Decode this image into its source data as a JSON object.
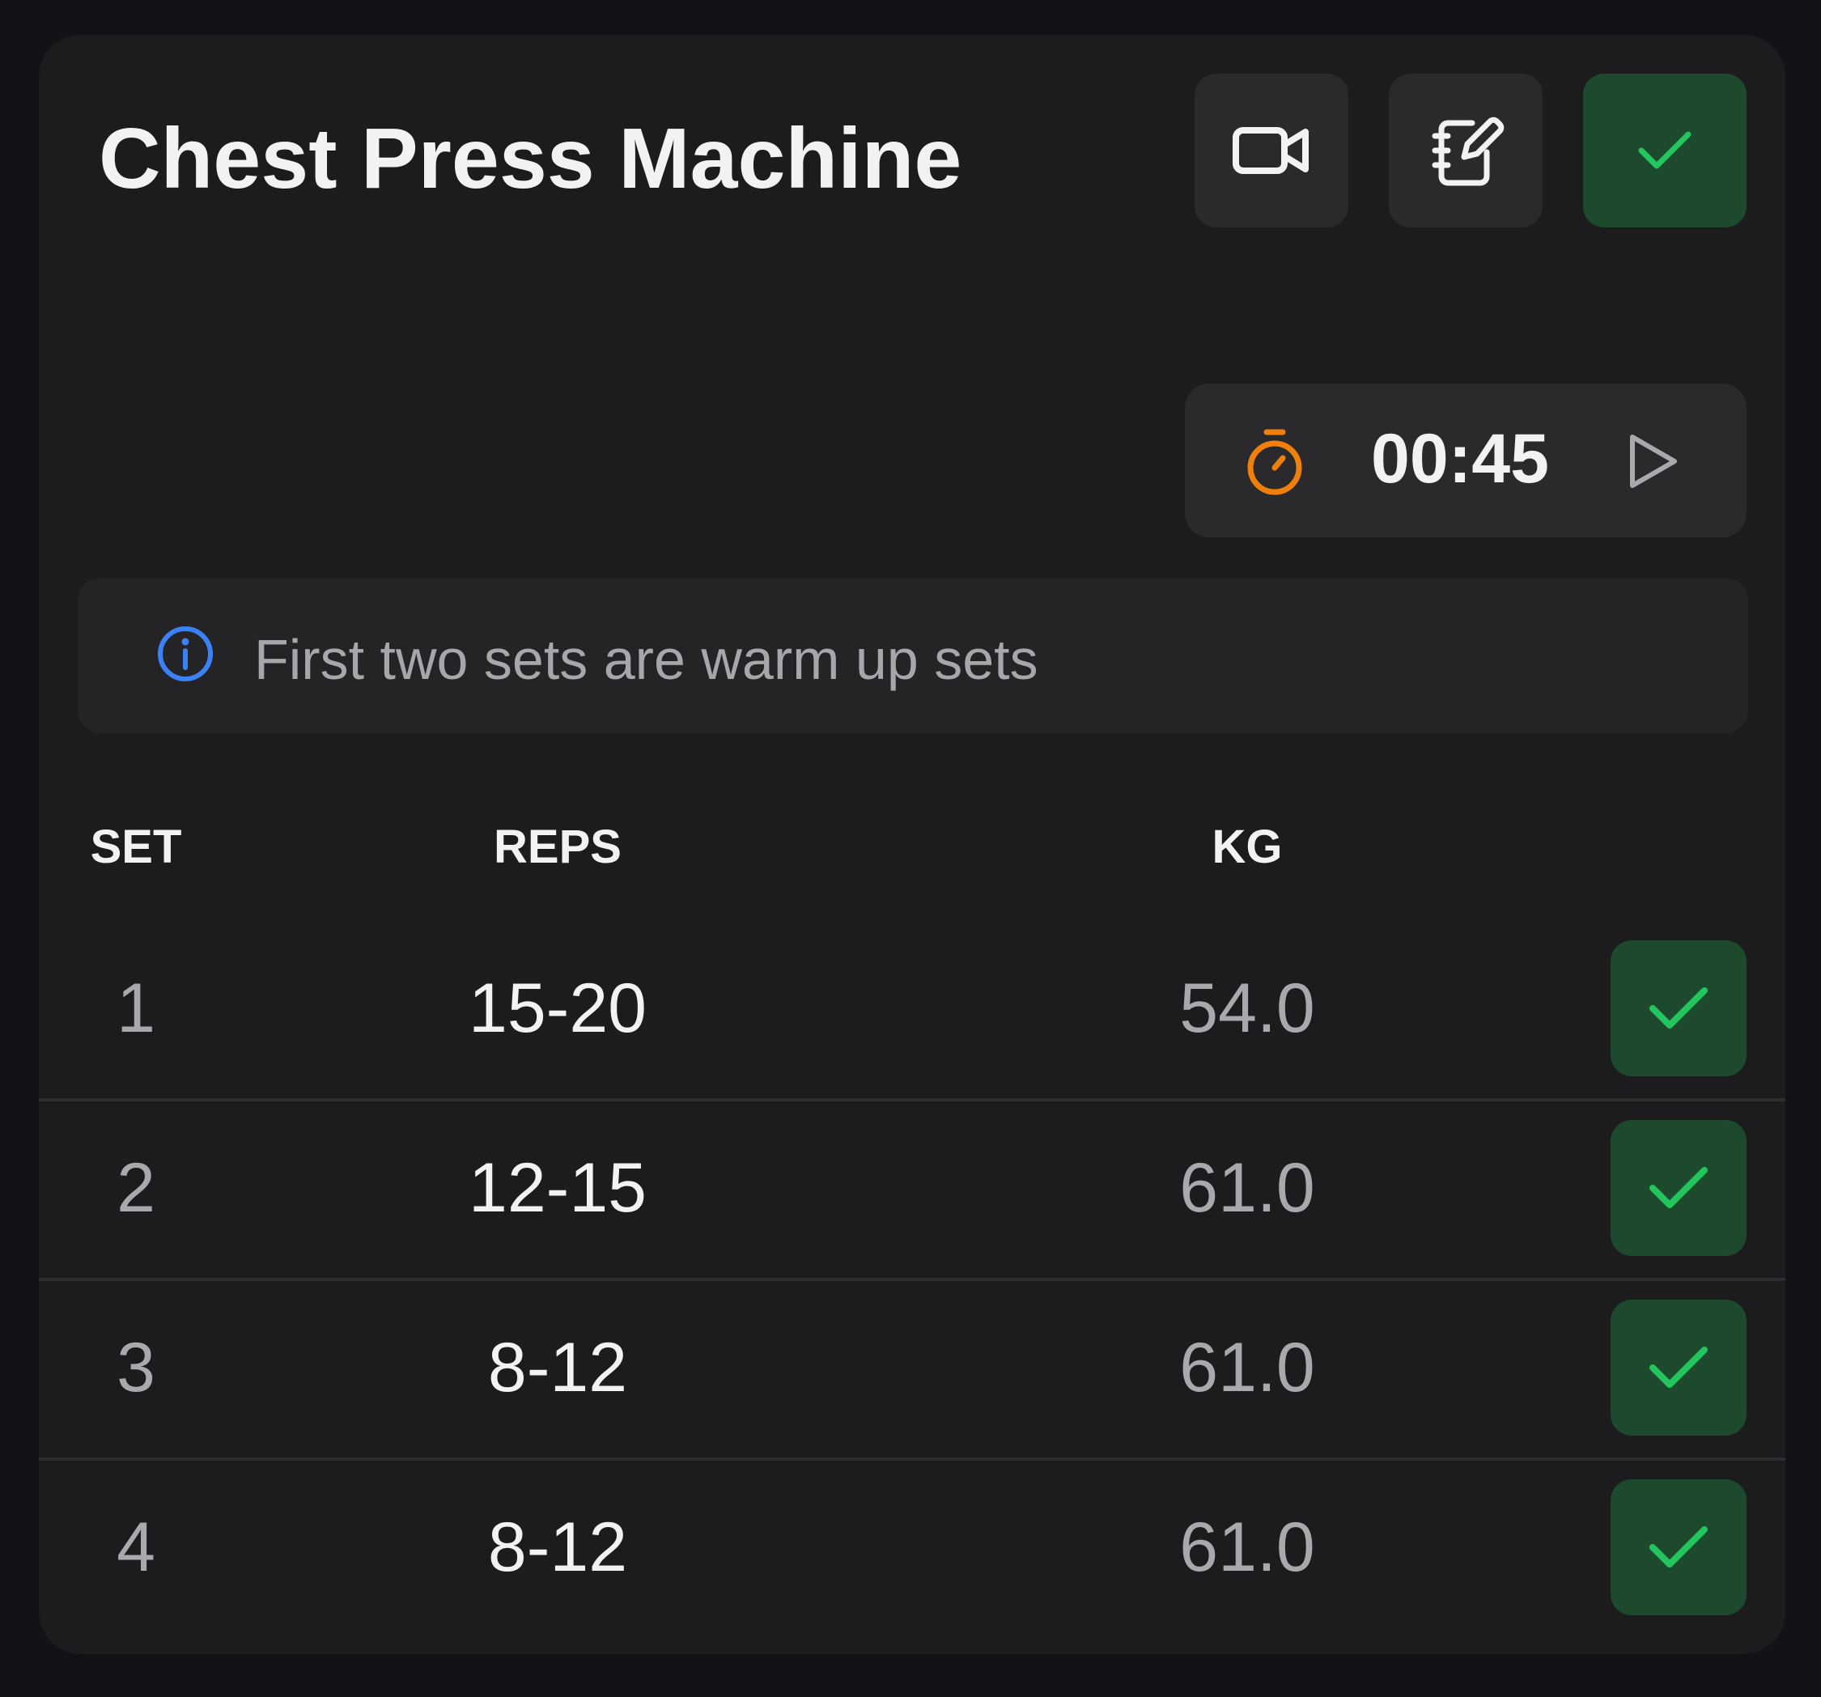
{
  "exercise": {
    "title": "Chest Press Machine",
    "actions": [
      {
        "icon": "video-camera-icon"
      },
      {
        "icon": "notebook-edit-icon"
      },
      {
        "icon": "checkmark-icon"
      }
    ]
  },
  "timer": {
    "icon": "stopwatch-icon",
    "value": "00:45",
    "play_icon": "play-icon"
  },
  "note": {
    "icon": "info-icon",
    "text": "First two sets are warm up sets"
  },
  "table": {
    "columns": [
      "SET",
      "REPS",
      "KG"
    ],
    "rows": [
      {
        "set": "1",
        "reps": "15-20",
        "kg": "54.0",
        "done": true
      },
      {
        "set": "2",
        "reps": "12-15",
        "kg": "61.0",
        "done": true
      },
      {
        "set": "3",
        "reps": "8-12",
        "kg": "61.0",
        "done": true
      },
      {
        "set": "4",
        "reps": "8-12",
        "kg": "61.0",
        "done": true
      }
    ]
  },
  "colors": {
    "background": "#121316",
    "card": "#1c1c1f",
    "button": "#2a2a2d",
    "success_bg": "#1d4a2c",
    "success": "#22c55e",
    "timer_accent": "#f07f0c",
    "info_accent": "#3b82f6"
  }
}
